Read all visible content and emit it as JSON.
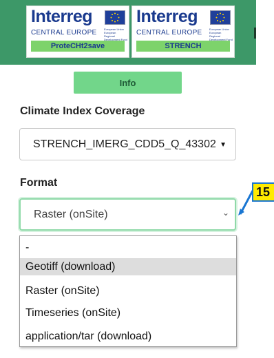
{
  "header": {
    "logos": [
      {
        "word": "Interreg",
        "region": "CENTRAL EUROPE",
        "small_text": "European Union European Regional Development Fund",
        "project": "ProteCHt2save"
      },
      {
        "word": "Interreg",
        "region": "CENTRAL EUROPE",
        "small_text": "European Union European Regional Development Fund",
        "project": "STRENCH"
      }
    ],
    "background_color": "#3d9868"
  },
  "info_button": {
    "label": "Info",
    "color": "#72d68a"
  },
  "coverage": {
    "label": "Climate Index Coverage",
    "selected": "STRENCH_IMERG_CDD5_Q_43302"
  },
  "format": {
    "label": "Format",
    "selected": "Raster (onSite)",
    "options": [
      {
        "label": "-",
        "highlighted": false
      },
      {
        "label": "Geotiff (download)",
        "highlighted": true
      },
      {
        "label": "Raster (onSite)",
        "highlighted": false
      },
      {
        "label": "Timeseries (onSite)",
        "highlighted": false
      },
      {
        "label": "application/tar (download)",
        "highlighted": false
      }
    ]
  },
  "annotation": {
    "number": "15",
    "color": "#ffeb00",
    "border_color": "#1976d2"
  }
}
